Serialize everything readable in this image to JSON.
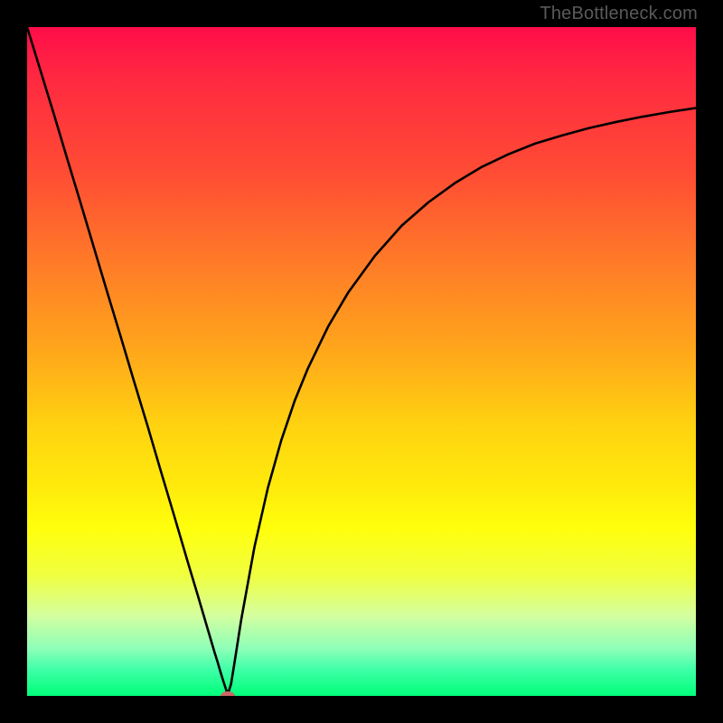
{
  "watermark": "TheBottleneck.com",
  "chart_data": {
    "type": "line",
    "title": "",
    "xlabel": "",
    "ylabel": "",
    "xlim": [
      0,
      100
    ],
    "ylim": [
      0,
      100
    ],
    "grid": false,
    "series": [
      {
        "name": "bottleneck-curve",
        "color": "#000000",
        "x": [
          0,
          2,
          4,
          6,
          8,
          10,
          12,
          14,
          16,
          18,
          20,
          22,
          24,
          25.5,
          27,
          28,
          28.5,
          29,
          29.5,
          30,
          30.5,
          31,
          31.5,
          32,
          34,
          36,
          38,
          40,
          42,
          45,
          48,
          52,
          56,
          60,
          64,
          68,
          72,
          76,
          80,
          84,
          88,
          92,
          96,
          100
        ],
        "y": [
          100,
          93.5,
          87,
          80.3,
          73.7,
          67,
          60.3,
          53.7,
          47,
          40.4,
          33.6,
          26.9,
          20.1,
          15.1,
          10,
          6.6,
          5,
          3.3,
          1.7,
          0.2,
          1.8,
          4.9,
          8.1,
          11.3,
          22.3,
          31.1,
          38.2,
          44.1,
          49,
          55.2,
          60.3,
          65.8,
          70.3,
          73.8,
          76.7,
          79.1,
          81.0,
          82.6,
          83.8,
          84.9,
          85.8,
          86.6,
          87.3,
          87.9
        ]
      }
    ],
    "marker": {
      "name": "minimum-marker",
      "x": 30,
      "y": 0,
      "color": "#cc6666",
      "rx": 8,
      "ry": 5
    },
    "background_gradient": {
      "top": "#ff0d4a",
      "upper_mid": "#ff9a20",
      "mid": "#ffe80c",
      "lower_mid": "#d4ffa0",
      "bottom": "#00ff7a"
    }
  }
}
